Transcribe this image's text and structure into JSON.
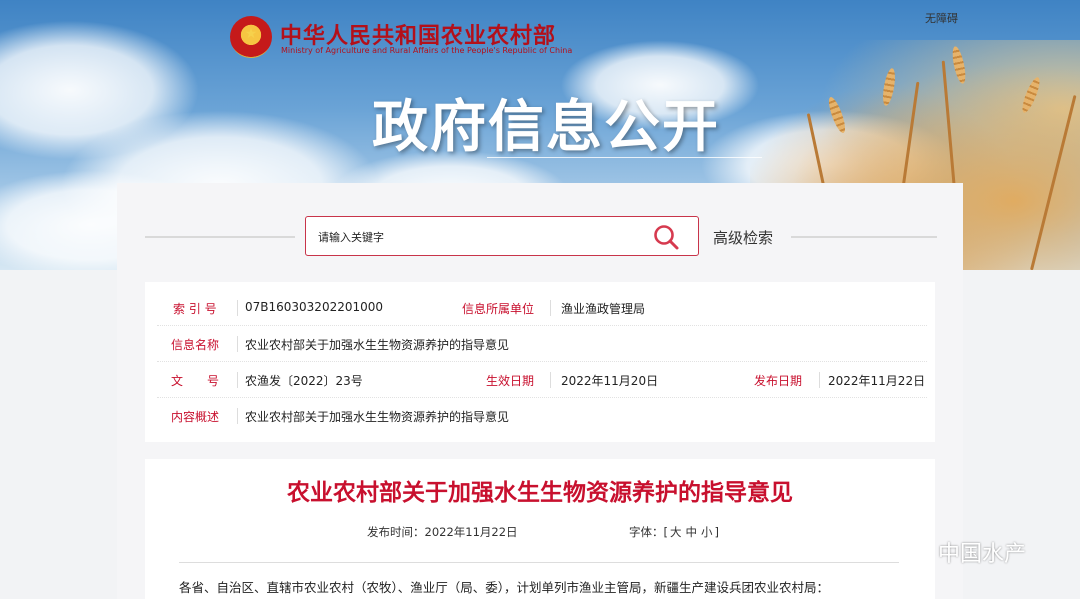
{
  "header": {
    "ministry_cn": "中华人民共和国农业农村部",
    "ministry_en": "Ministry of Agriculture and Rural Affairs of the People's Republic of China",
    "accessibility": "无障碍",
    "section_title": "政府信息公开"
  },
  "search": {
    "placeholder": "请输入关键字",
    "advanced_label": "高级检索",
    "accent": "#c8344a"
  },
  "info": {
    "index_label": "索 引 号",
    "index_value": "07B160303202201000",
    "org_label": "信息所属单位",
    "org_value": "渔业渔政管理局",
    "name_label": "信息名称",
    "name_value": "农业农村部关于加强水生生物资源养护的指导意见",
    "doc_label": "文　　号",
    "doc_value": "农渔发〔2022〕23号",
    "effective_label": "生效日期",
    "effective_value": "2022年11月20日",
    "publish_label": "发布日期",
    "publish_value": "2022年11月22日",
    "summary_label": "内容概述",
    "summary_value": "农业农村部关于加强水生生物资源养护的指导意见"
  },
  "article": {
    "title": "农业农村部关于加强水生生物资源养护的指导意见",
    "publish_time": "发布时间：2022年11月22日",
    "font_label": "字体：[",
    "font_large": "大",
    "font_medium": "中",
    "font_small": "小",
    "font_close": "]",
    "body_first_line": "各省、自治区、直辖市农业农村（农牧）、渔业厅（局、委），计划单列市渔业主管局，新疆生产建设兵团农业农村局："
  },
  "watermark": "中国水产",
  "colors": {
    "brand_red": "#c8102e",
    "banner_sky": "#4a8ccc"
  }
}
